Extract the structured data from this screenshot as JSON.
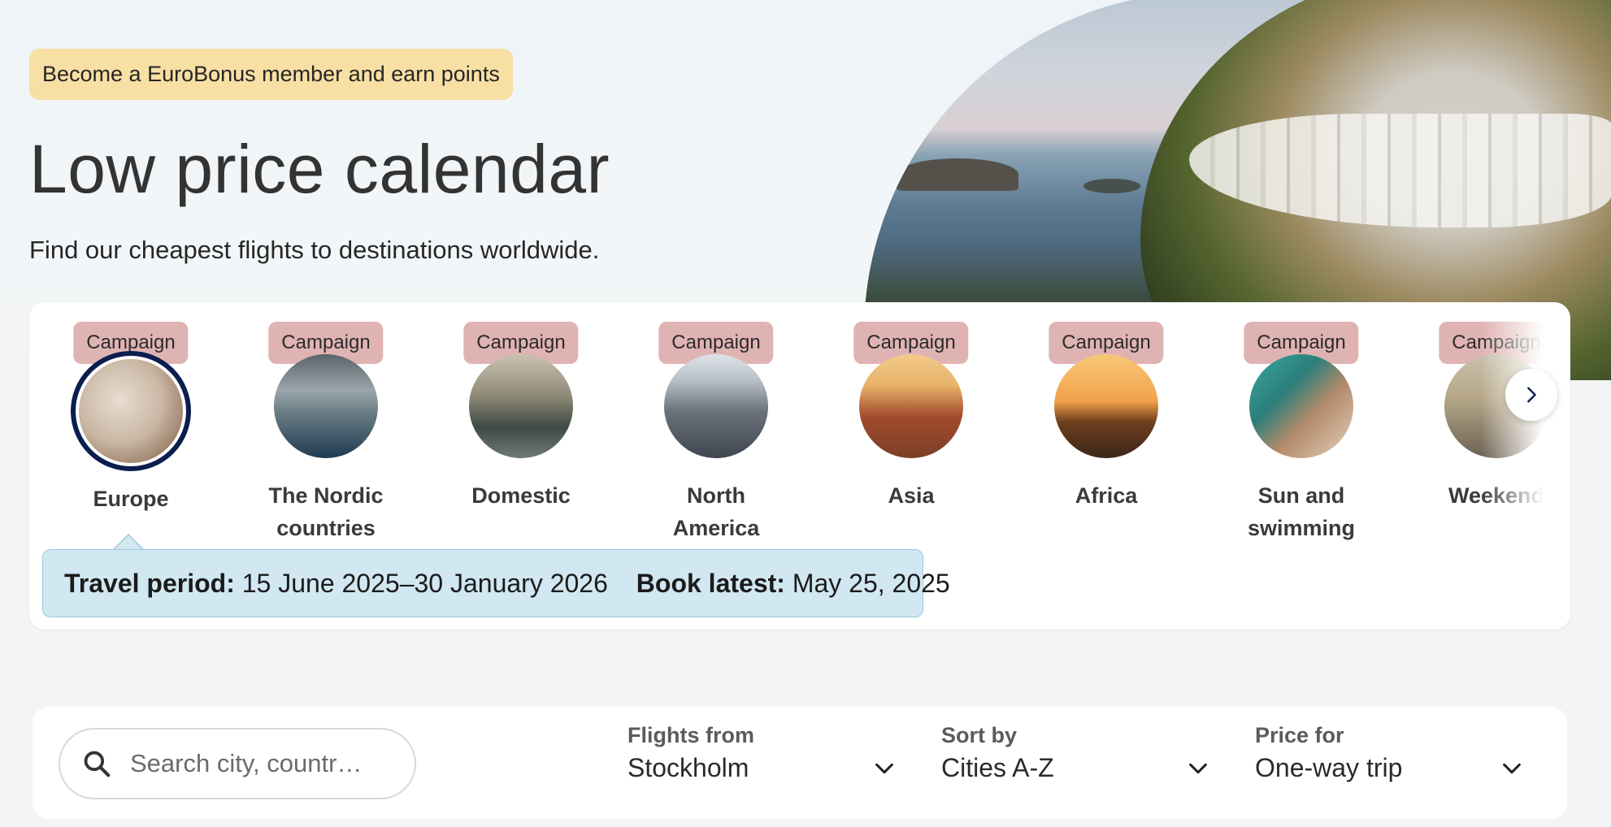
{
  "hero": {
    "badge": "Become a EuroBonus member and earn points",
    "title": "Low price calendar",
    "subtitle": "Find our cheapest flights to destinations worldwide."
  },
  "categories": {
    "tag": "Campaign",
    "items": [
      {
        "label": "Europe",
        "selected": true,
        "image_colors": [
          "#c9b7a4",
          "#8a6a52"
        ]
      },
      {
        "label": "The Nordic countries",
        "image_colors": [
          "#6c7f86",
          "#1f3a52"
        ]
      },
      {
        "label": "Domestic",
        "image_colors": [
          "#8f8a78",
          "#3d4a44"
        ]
      },
      {
        "label": "North America",
        "image_colors": [
          "#b9c1c8",
          "#3f4650"
        ]
      },
      {
        "label": "Asia",
        "image_colors": [
          "#e8b36a",
          "#7b3f28"
        ]
      },
      {
        "label": "Africa",
        "image_colors": [
          "#f2a24a",
          "#3b2518"
        ]
      },
      {
        "label": "Sun and swimming",
        "image_colors": [
          "#3aa6a0",
          "#b48a6a"
        ]
      },
      {
        "label": "Weekend",
        "image_colors": [
          "#b7a989",
          "#6c6052"
        ]
      }
    ]
  },
  "info": {
    "period_label": "Travel period:",
    "period_value": "15 June 2025–30 January 2026",
    "book_label": "Book latest:",
    "book_value": "May 25, 2025"
  },
  "filters": {
    "search_placeholder": "Search city, countr…",
    "from_label": "Flights from",
    "from_value": "Stockholm",
    "sort_label": "Sort by",
    "sort_value": "Cities A-Z",
    "price_label": "Price for",
    "price_value": "One-way trip"
  },
  "colors": {
    "badge_bg": "#f8dfa4",
    "campaign_tag": "#e0b3b3",
    "info_bg": "#d1e7f2",
    "selected_ring": "#0b1e50"
  },
  "icons": [
    "search-icon",
    "chevron-right-icon",
    "chevron-down-icon"
  ]
}
